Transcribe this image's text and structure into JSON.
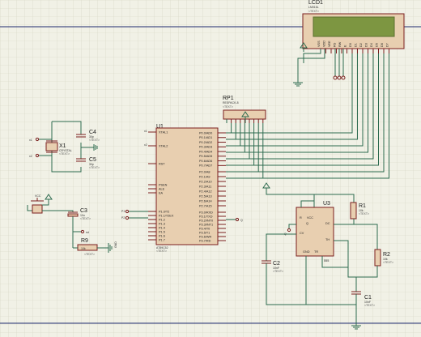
{
  "components": {
    "lcd": {
      "ref": "LCD1",
      "part": "LM016L",
      "text": "<TEXT>",
      "pins": [
        "VSS",
        "VDD",
        "VEE",
        "RS",
        "RW",
        "E",
        "D0",
        "D1",
        "D2",
        "D3",
        "D4",
        "D5",
        "D6",
        "D7"
      ]
    },
    "rp1": {
      "ref": "RP1",
      "part": "RESPACK-8",
      "text": "<TEXT>"
    },
    "u1": {
      "ref": "U1",
      "part": "AT89C52",
      "text": "<TEXT>",
      "left_pins": [
        "XTAL1",
        "XTAL2",
        "RST",
        "PSEN",
        "ALE",
        "EA",
        "P1.0/T2",
        "P1.1/T2EX",
        "P1.2",
        "P1.3",
        "P1.4",
        "P1.5",
        "P1.6",
        "P1.7"
      ],
      "right_pins": [
        "P0.0/AD0",
        "P0.1/AD1",
        "P0.2/AD2",
        "P0.3/AD3",
        "P0.4/AD4",
        "P0.5/AD5",
        "P0.6/AD6",
        "P0.7/AD7",
        "P2.0/A8",
        "P2.1/A9",
        "P2.2/A10",
        "P2.3/A11",
        "P2.4/A12",
        "P2.5/A13",
        "P2.6/A14",
        "P2.7/A15",
        "P3.0/RXD",
        "P3.1/TXD",
        "P3.2/INT0",
        "P3.3/INT1",
        "P3.4/T0",
        "P3.5/T1",
        "P3.6/WR",
        "P3.7/RD"
      ]
    },
    "u3": {
      "ref": "U3",
      "part": "555",
      "pins": [
        "VCC",
        "DC",
        "TH",
        "CV",
        "GND",
        "TR",
        "Q",
        "R"
      ]
    },
    "x1": {
      "ref": "X1",
      "part": "CRYSTAL",
      "text": "<TEXT>"
    },
    "c4": {
      "ref": "C4",
      "value": "30p",
      "text": "<TEXT>"
    },
    "c5": {
      "ref": "C5",
      "value": "30p",
      "text": "<TEXT>"
    },
    "c3": {
      "ref": "C3",
      "value": "10u",
      "text": "<TEXT>"
    },
    "r9": {
      "ref": "R9",
      "value": "10k",
      "text": "<TEXT>"
    },
    "r1": {
      "ref": "R1",
      "value": "10k",
      "text": "<TEXT>"
    },
    "r2": {
      "ref": "R2",
      "value": "10k",
      "text": "<TEXT>"
    },
    "c2": {
      "ref": "C2",
      "value": "10nF",
      "text": "<TEXT>"
    },
    "c1": {
      "ref": "C1",
      "value": "10nF",
      "text": "<TEXT>"
    }
  },
  "net_labels": {
    "x1_left": "x1",
    "x2_left": "x2",
    "x1_u1": "x1",
    "x2_u1": "x2",
    "p10": "P1",
    "p11": "P2",
    "q_u1": "Q",
    "q_u3": "Q",
    "gnd": "GND",
    "vcc": "VCC"
  }
}
